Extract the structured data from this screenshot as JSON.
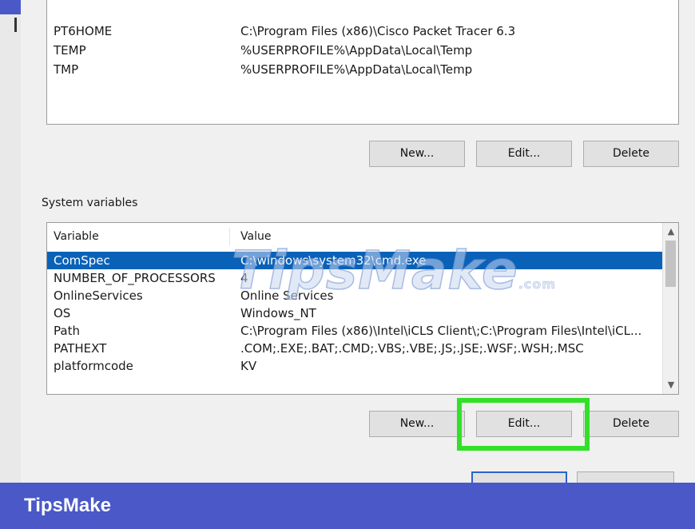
{
  "user_variables": {
    "rows": [
      {
        "variable": "PT6HOME",
        "value": "C:\\Program Files (x86)\\Cisco Packet Tracer 6.3"
      },
      {
        "variable": "TEMP",
        "value": "%USERPROFILE%\\AppData\\Local\\Temp"
      },
      {
        "variable": "TMP",
        "value": "%USERPROFILE%\\AppData\\Local\\Temp"
      }
    ],
    "buttons": {
      "new": "New...",
      "edit": "Edit...",
      "delete": "Delete"
    }
  },
  "system_variables": {
    "label": "System variables",
    "columns": {
      "variable": "Variable",
      "value": "Value"
    },
    "rows": [
      {
        "variable": "ComSpec",
        "value": "C:\\windows\\system32\\cmd.exe",
        "selected": true
      },
      {
        "variable": "NUMBER_OF_PROCESSORS",
        "value": "4"
      },
      {
        "variable": "OnlineServices",
        "value": "Online Services"
      },
      {
        "variable": "OS",
        "value": "Windows_NT"
      },
      {
        "variable": "Path",
        "value": "C:\\Program Files (x86)\\Intel\\iCLS Client\\;C:\\Program Files\\Intel\\iCL..."
      },
      {
        "variable": "PATHEXT",
        "value": ".COM;.EXE;.BAT;.CMD;.VBS;.VBE;.JS;.JSE;.WSF;.WSH;.MSC"
      },
      {
        "variable": "platformcode",
        "value": "KV"
      }
    ],
    "buttons": {
      "new": "New...",
      "edit": "Edit...",
      "delete": "Delete"
    }
  },
  "icons": {
    "scroll_up": "chevron-up-icon",
    "scroll_down": "chevron-down-icon"
  },
  "watermark": {
    "main": "TipsMake",
    "tld": ".com"
  },
  "brand": {
    "name": "TipsMake"
  },
  "colors": {
    "brand_bar": "#4a58c8",
    "selection": "#0a62b8",
    "highlight": "#33e028"
  }
}
